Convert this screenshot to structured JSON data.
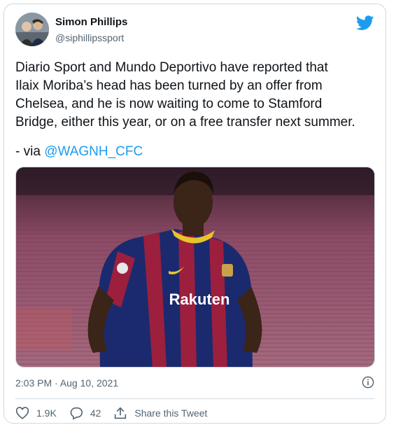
{
  "author": {
    "name": "Simon Phillips",
    "handle": "@siphillipssport"
  },
  "tweet": {
    "text": "Diario Sport and Mundo Deportivo have reported that\nIlaix Moriba’s head has been turned by an offer from\nChelsea, and he is now waiting to come to Stamford\nBridge, either this year, or on a free transfer next summer.",
    "via_prefix": "- via ",
    "via_mention": "@WAGNH_CFC",
    "media_shirt_text": "Rakuten"
  },
  "meta": {
    "timestamp": "2:03 PM · Aug 10, 2021"
  },
  "actions": {
    "likes": "1.9K",
    "replies": "42",
    "share_label": "Share this Tweet"
  },
  "colors": {
    "twitter_blue": "#1d9bf0",
    "text_primary": "#0f1419",
    "text_secondary": "#536471",
    "border": "#cfd9de"
  },
  "icons": [
    "twitter-bird-icon",
    "info-icon",
    "heart-icon",
    "reply-icon",
    "share-icon"
  ]
}
